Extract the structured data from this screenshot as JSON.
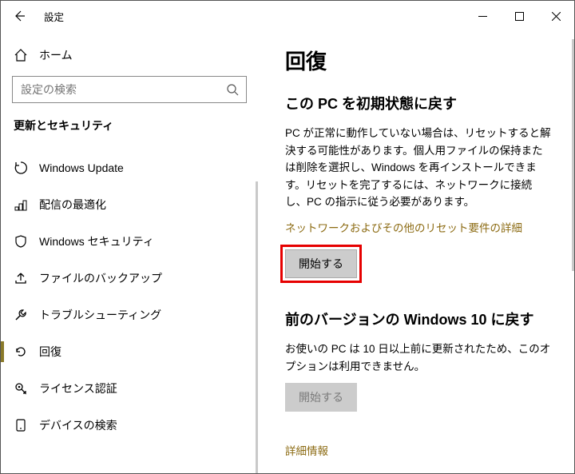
{
  "window": {
    "title": "設定"
  },
  "left": {
    "home": "ホーム",
    "search_placeholder": "設定の検索",
    "section": "更新とセキュリティ",
    "items": [
      {
        "id": "windows-update",
        "label": "Windows Update",
        "selected": false
      },
      {
        "id": "delivery-opt",
        "label": "配信の最適化",
        "selected": false
      },
      {
        "id": "windows-security",
        "label": "Windows セキュリティ",
        "selected": false
      },
      {
        "id": "backup",
        "label": "ファイルのバックアップ",
        "selected": false
      },
      {
        "id": "troubleshoot",
        "label": "トラブルシューティング",
        "selected": false
      },
      {
        "id": "recovery",
        "label": "回復",
        "selected": true
      },
      {
        "id": "activation",
        "label": "ライセンス認証",
        "selected": false
      },
      {
        "id": "find-device",
        "label": "デバイスの検索",
        "selected": false
      }
    ]
  },
  "right": {
    "page_title": "回復",
    "reset": {
      "heading": "この PC を初期状態に戻す",
      "body": "PC が正常に動作していない場合は、リセットすると解決する可能性があります。個人用ファイルの保持または削除を選択し、Windows を再インストールできます。リセットを完了するには、ネットワークに接続し、PC の指示に従う必要があります。",
      "link": "ネットワークおよびその他のリセット要件の詳細",
      "button": "開始する"
    },
    "goback": {
      "heading": "前のバージョンの Windows 10 に戻す",
      "body": "お使いの PC は 10 日以上前に更新されたため、このオプションは利用できません。",
      "button": "開始する"
    },
    "moreinfo": "詳細情報"
  }
}
